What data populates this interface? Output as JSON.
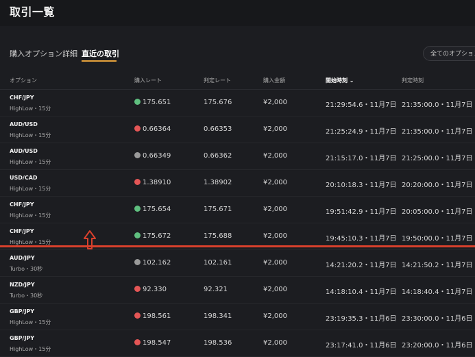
{
  "page_title": "取引一覧",
  "tabs": [
    {
      "label": "購入オプション詳細"
    },
    {
      "label": "直近の取引"
    }
  ],
  "filter_label": "全てのオプション",
  "columns": {
    "option": "オプション",
    "purchase_rate": "購入レート",
    "judge_rate": "判定レート",
    "amount": "購入金額",
    "start_time": "開始時刻 ⌄",
    "judge_time": "判定時刻"
  },
  "rows": [
    {
      "pair": "CHF/JPY",
      "type": "HighLow・15分",
      "direction": "up",
      "purchase_rate": "175.651",
      "judge_rate": "175.676",
      "amount": "¥2,000",
      "start": "21:29:54.6・11月7日",
      "end": "21:35:00.0・11月7日"
    },
    {
      "pair": "AUD/USD",
      "type": "HighLow・15分",
      "direction": "down",
      "purchase_rate": "0.66364",
      "judge_rate": "0.66353",
      "amount": "¥2,000",
      "start": "21:25:24.9・11月7日",
      "end": "21:35:00.0・11月7日"
    },
    {
      "pair": "AUD/USD",
      "type": "HighLow・15分",
      "direction": "flat",
      "purchase_rate": "0.66349",
      "judge_rate": "0.66362",
      "amount": "¥2,000",
      "start": "21:15:17.0・11月7日",
      "end": "21:25:00.0・11月7日"
    },
    {
      "pair": "USD/CAD",
      "type": "HighLow・15分",
      "direction": "down",
      "purchase_rate": "1.38910",
      "judge_rate": "1.38902",
      "amount": "¥2,000",
      "start": "20:10:18.3・11月7日",
      "end": "20:20:00.0・11月7日"
    },
    {
      "pair": "CHF/JPY",
      "type": "HighLow・15分",
      "direction": "up",
      "purchase_rate": "175.654",
      "judge_rate": "175.671",
      "amount": "¥2,000",
      "start": "19:51:42.9・11月7日",
      "end": "20:05:00.0・11月7日"
    },
    {
      "pair": "CHF/JPY",
      "type": "HighLow・15分",
      "direction": "up",
      "purchase_rate": "175.672",
      "judge_rate": "175.688",
      "amount": "¥2,000",
      "start": "19:45:10.3・11月7日",
      "end": "19:50:00.0・11月7日"
    },
    {
      "pair": "AUD/JPY",
      "type": "Turbo・30秒",
      "direction": "flat",
      "purchase_rate": "102.162",
      "judge_rate": "102.161",
      "amount": "¥2,000",
      "start": "14:21:20.2・11月7日",
      "end": "14:21:50.2・11月7日"
    },
    {
      "pair": "NZD/JPY",
      "type": "Turbo・30秒",
      "direction": "down",
      "purchase_rate": "92.330",
      "judge_rate": "92.321",
      "amount": "¥2,000",
      "start": "14:18:10.4・11月7日",
      "end": "14:18:40.4・11月7日"
    },
    {
      "pair": "GBP/JPY",
      "type": "HighLow・15分",
      "direction": "down",
      "purchase_rate": "198.561",
      "judge_rate": "198.341",
      "amount": "¥2,000",
      "start": "23:19:35.3・11月6日",
      "end": "23:30:00.0・11月6日"
    },
    {
      "pair": "GBP/JPY",
      "type": "HighLow・15分",
      "direction": "down",
      "purchase_rate": "198.547",
      "judge_rate": "198.536",
      "amount": "¥2,000",
      "start": "23:17:41.0・11月6日",
      "end": "23:20:00.0・11月6日"
    }
  ]
}
